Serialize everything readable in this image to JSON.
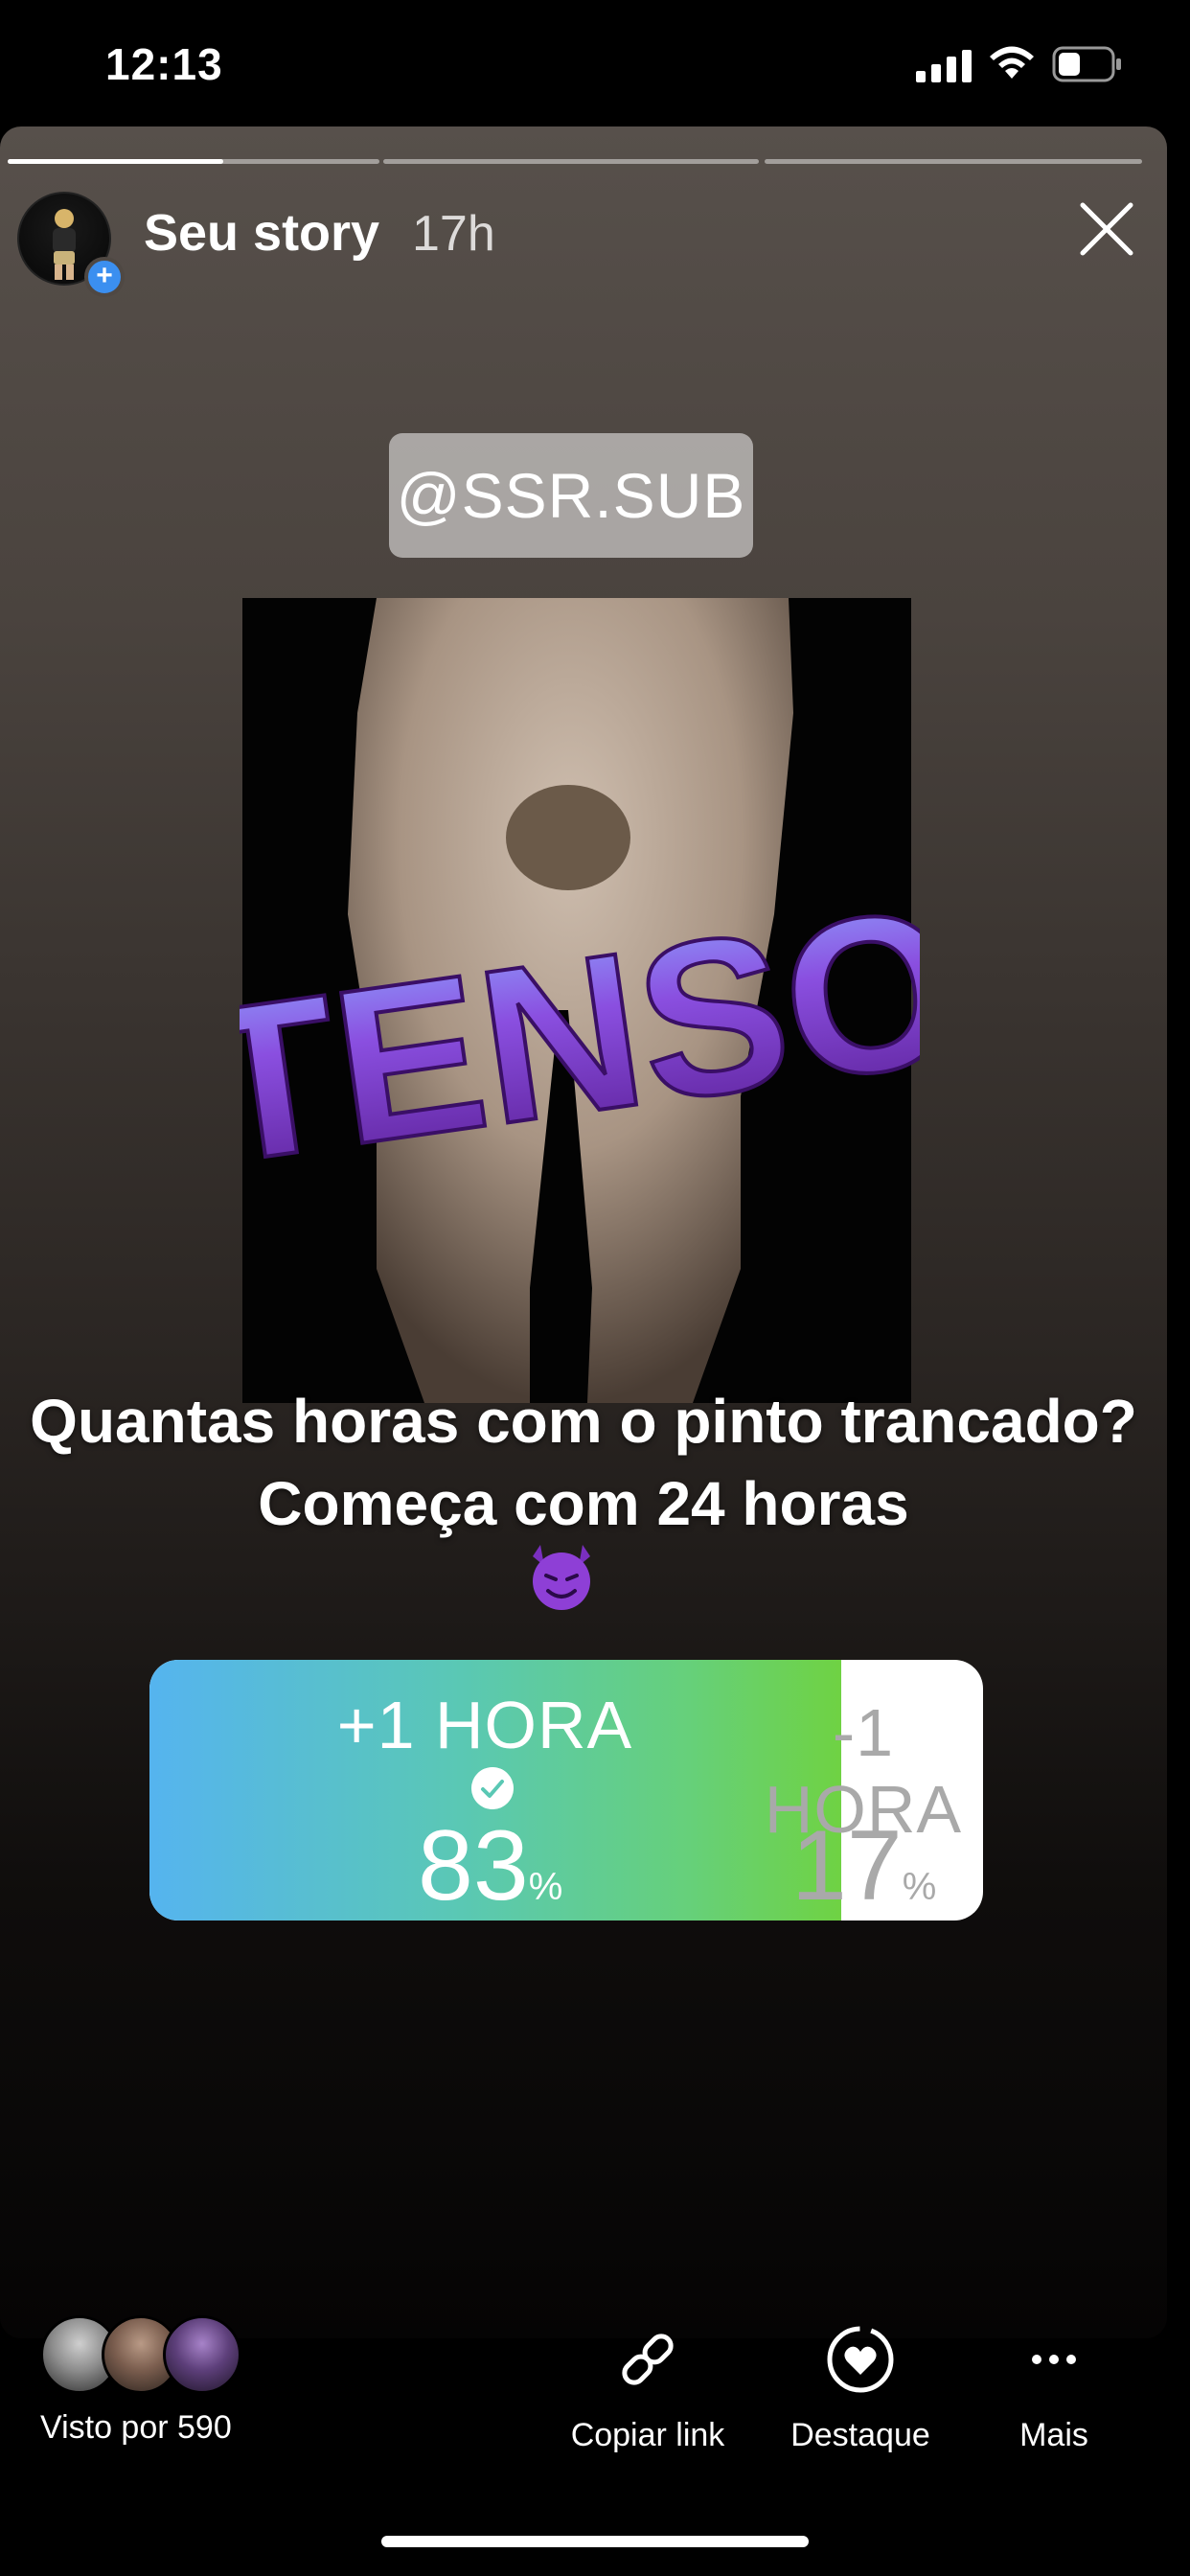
{
  "status_bar": {
    "time": "12:13"
  },
  "story": {
    "title": "Seu story",
    "age": "17h",
    "progress": [
      0.58,
      0,
      0
    ],
    "tag": "@SSR.SUB",
    "sticker_text": "TENSO",
    "question": "Quantas horas com o pinto trancado?  Começa com 24 horas",
    "poll": {
      "option1_label": "+1 HORA",
      "option1_percent": "83",
      "option2_label": "-1 HORA",
      "option2_percent": "17",
      "percent_sign": "%"
    }
  },
  "bottom_bar": {
    "seen_by": "Visto por 590",
    "copy_link": "Copiar link",
    "highlight": "Destaque",
    "more": "Mais"
  },
  "colors": {
    "poll_gradient_start": "#55b4ef",
    "poll_gradient_end": "#6fd243",
    "sticker_purple": "#7d35c9",
    "sticker_blue": "#8fa6ff"
  }
}
